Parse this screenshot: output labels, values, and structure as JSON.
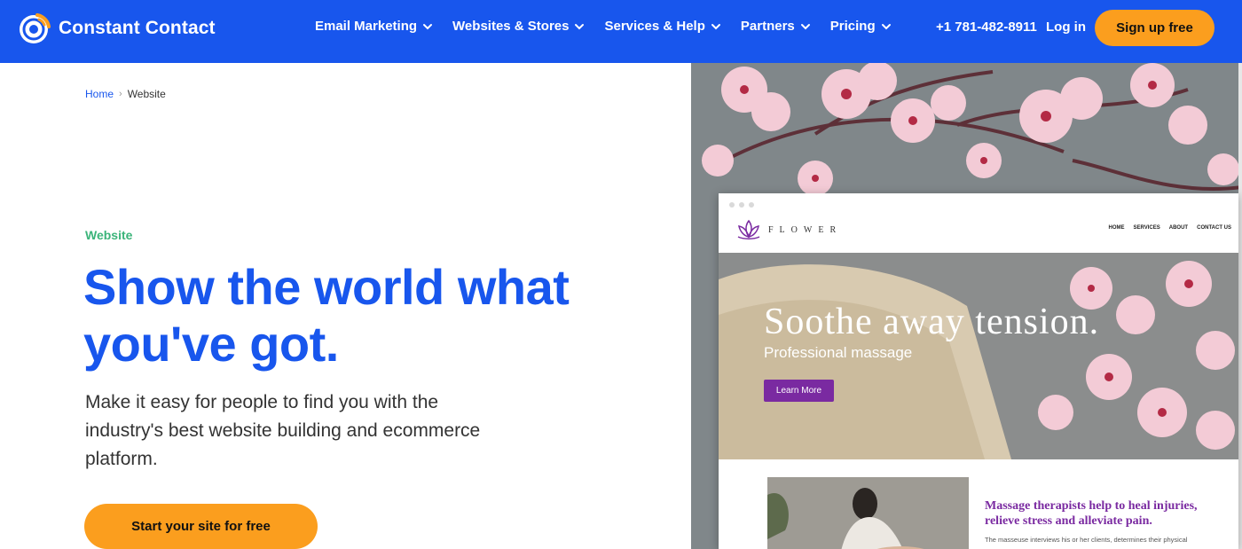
{
  "header": {
    "brand": "Constant Contact",
    "logo_icon": "constant-contact-logo-icon",
    "nav": [
      {
        "label": "Email Marketing",
        "icon": "chevron-down-icon"
      },
      {
        "label": "Websites & Stores",
        "icon": "chevron-down-icon"
      },
      {
        "label": "Services & Help",
        "icon": "chevron-down-icon"
      },
      {
        "label": "Partners",
        "icon": "chevron-down-icon"
      },
      {
        "label": "Pricing",
        "icon": "chevron-down-icon"
      }
    ],
    "phone": "+1 781-482-8911",
    "login": "Log in",
    "signup": "Sign up free"
  },
  "breadcrumb": {
    "home": "Home",
    "separator": "›",
    "current": "Website"
  },
  "hero": {
    "eyebrow": "Website",
    "title": "Show the world what you've got.",
    "subtitle": "Make it easy for people to find you with the industry's best website building and ecommerce platform.",
    "cta": "Start your site for free"
  },
  "mockup": {
    "site_name": "FLOWER",
    "menu": [
      "HOME",
      "SERVICES",
      "ABOUT",
      "CONTACT US"
    ],
    "hero_title": "Soothe away tension.",
    "hero_subtitle": "Professional massage",
    "hero_button": "Learn More",
    "section_heading": "Massage therapists help to heal injuries, relieve stress and alleviate pain.",
    "section_body": "The masseuse interviews his or her clients, determines their physical"
  },
  "colors": {
    "brand_blue": "#1856ed",
    "cta_orange": "#fb9e1e",
    "eyebrow_green": "#3bb47a",
    "mockup_purple": "#7a2aa1"
  }
}
